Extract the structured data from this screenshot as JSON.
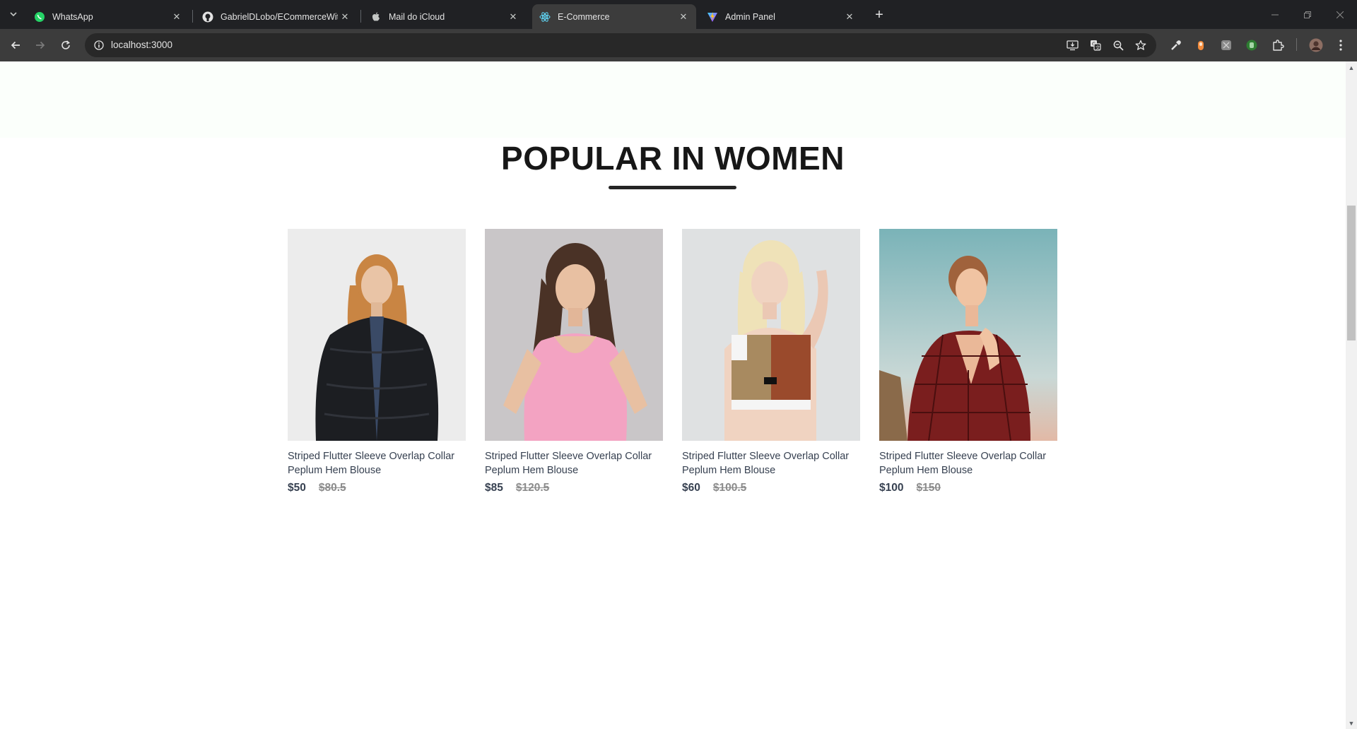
{
  "browser": {
    "tabs": [
      {
        "title": "WhatsApp",
        "icon": "whatsapp-icon"
      },
      {
        "title": "GabrielDLobo/ECommerceWith",
        "icon": "github-icon"
      },
      {
        "title": "Mail do iCloud",
        "icon": "apple-icon"
      },
      {
        "title": "E-Commerce",
        "icon": "react-icon",
        "active": true
      },
      {
        "title": "Admin Panel",
        "icon": "vite-icon"
      }
    ],
    "close_glyph": "✕",
    "new_tab_glyph": "+",
    "url": "localhost:3000"
  },
  "page": {
    "section_title": "POPULAR IN WOMEN",
    "products": [
      {
        "name": "Striped Flutter Sleeve Overlap Collar Peplum Hem Blouse",
        "new_price": "$50",
        "old_price": "$80.5",
        "image": "woman-black-fur-jacket"
      },
      {
        "name": "Striped Flutter Sleeve Overlap Collar Peplum Hem Blouse",
        "new_price": "$85",
        "old_price": "$120.5",
        "image": "woman-pink-top"
      },
      {
        "name": "Striped Flutter Sleeve Overlap Collar Peplum Hem Blouse",
        "new_price": "$60",
        "old_price": "$100.5",
        "image": "woman-sports-bra"
      },
      {
        "name": "Striped Flutter Sleeve Overlap Collar Peplum Hem Blouse",
        "new_price": "$100",
        "old_price": "$150",
        "image": "woman-red-plaid-dress"
      }
    ]
  },
  "colors": {
    "chrome_dark": "#202124",
    "toolbar": "#3c3c3c",
    "title_text": "#171717",
    "price_text": "#374151",
    "old_price_text": "#8c8c8c"
  }
}
